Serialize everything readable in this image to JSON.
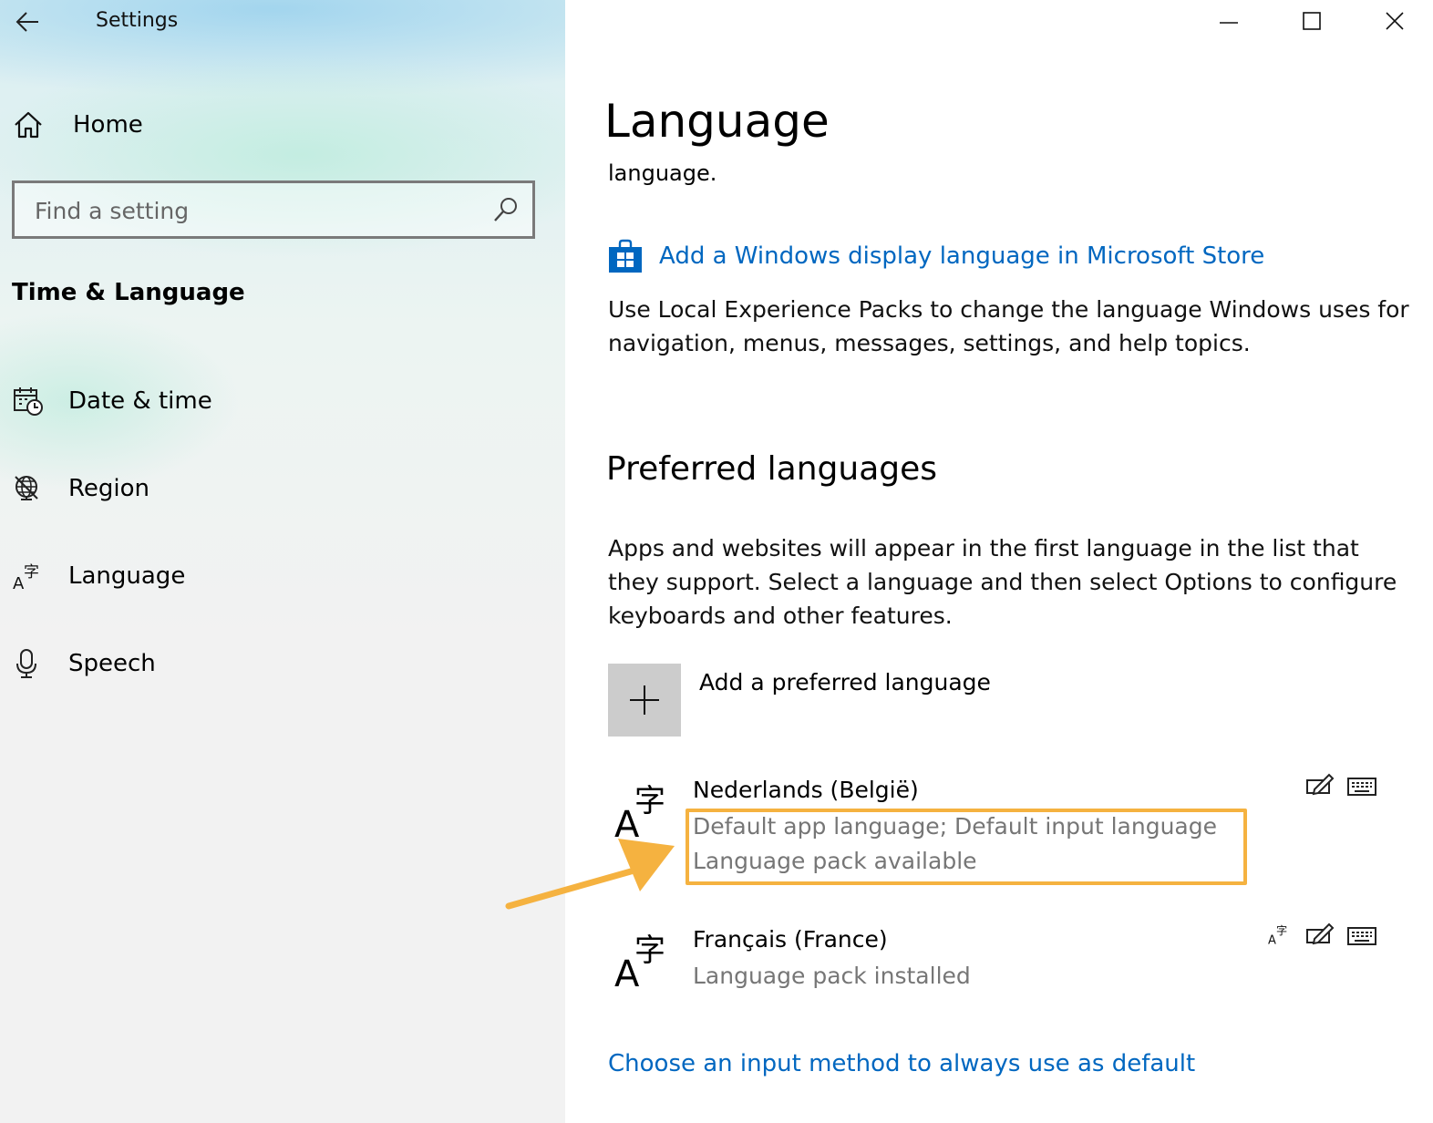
{
  "window": {
    "title": "Settings",
    "controls": [
      "minimize-icon",
      "maximize-icon",
      "close-icon"
    ]
  },
  "sidebar": {
    "home_label": "Home",
    "search": {
      "placeholder": "Find a setting"
    },
    "section_title": "Time & Language",
    "items": [
      {
        "label": "Date & time",
        "icon": "calendar-clock-icon"
      },
      {
        "label": "Region",
        "icon": "globe-icon"
      },
      {
        "label": "Language",
        "icon": "language-icon"
      },
      {
        "label": "Speech",
        "icon": "microphone-icon"
      }
    ]
  },
  "main": {
    "title": "Language",
    "subtitle_fragment": "language.",
    "store_link": "Add a Windows display language in Microsoft Store",
    "store_description": "Use Local Experience Packs to change the language Windows uses for navigation, menus, messages, settings, and help topics.",
    "preferred_heading": "Preferred languages",
    "preferred_description": "Apps and websites will appear in the first language in the list that they support. Select a language and then select Options to configure keyboards and other features.",
    "add_language_label": "Add a preferred language",
    "languages": [
      {
        "name": "Nederlands (België)",
        "status_line1": "Default app language; Default input language",
        "status_line2": "Language pack available",
        "feature_icons": [
          "handwriting-icon",
          "keyboard-icon"
        ]
      },
      {
        "name": "Français (France)",
        "status_line1": "Language pack installed",
        "feature_icons": [
          "display-language-icon",
          "handwriting-icon",
          "keyboard-icon"
        ]
      }
    ],
    "input_method_link": "Choose an input method to always use as default"
  },
  "annotation": {
    "highlight_color": "#f5b240",
    "arrow_color": "#f5b240"
  },
  "colors": {
    "link": "#0067c0",
    "secondary_text": "#767676",
    "add_tile": "#cccccc"
  }
}
